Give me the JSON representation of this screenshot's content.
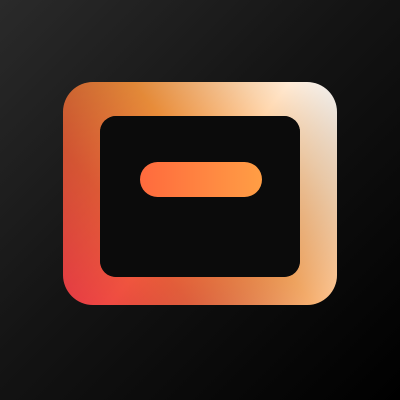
{
  "app_icon": {
    "name": "window-frame-icon",
    "colors": {
      "background_light": "#2a2a2a",
      "background_dark": "#000000",
      "frame_gradient": [
        "#ee3d47",
        "#f0603a",
        "#ff9a3f",
        "#ffd8b0",
        "#ffffff"
      ],
      "bar_gradient": [
        "#ff6a3d",
        "#ff9e45"
      ],
      "inner_fill": "#0b0b0b"
    }
  }
}
